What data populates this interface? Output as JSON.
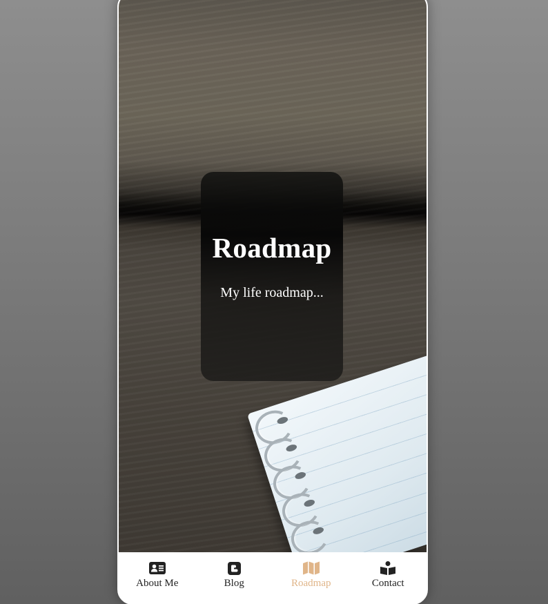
{
  "hero": {
    "title": "Roadmap",
    "subtitle": "My life roadmap..."
  },
  "nav": {
    "items": [
      {
        "label": "About Me",
        "icon": "id-card-icon"
      },
      {
        "label": "Blog",
        "icon": "blogger-icon"
      },
      {
        "label": "Roadmap",
        "icon": "map-icon",
        "active": true
      },
      {
        "label": "Contact",
        "icon": "contact-reader-icon"
      }
    ],
    "active_color": "#e0b589",
    "color": "#222222"
  }
}
